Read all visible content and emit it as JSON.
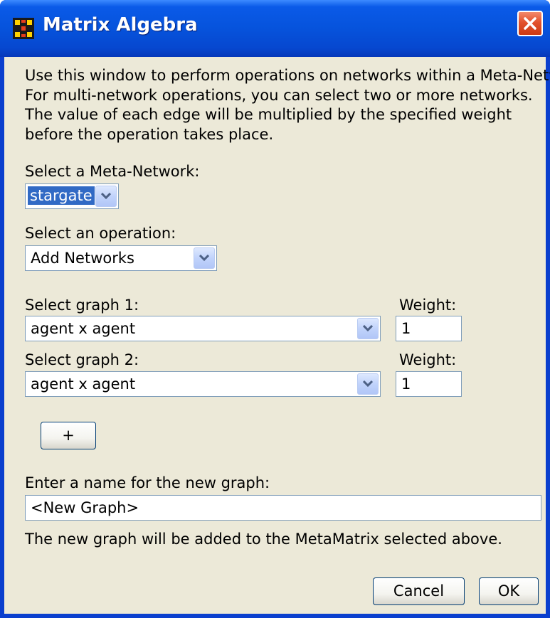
{
  "window": {
    "title": "Matrix Algebra",
    "icon": "ora-app-icon",
    "close_icon": "close-icon"
  },
  "intro": {
    "line1": "Use this window to perform operations on networks within a Meta-Network.",
    "line2": "For multi-network operations, you can select two or more networks.",
    "line3": "The value of each edge will be multiplied by the specified weight",
    "line4": "before the operation takes place."
  },
  "meta_network": {
    "label": "Select a Meta-Network:",
    "value": "stargate"
  },
  "operation": {
    "label": "Select an operation:",
    "value": "Add Networks"
  },
  "graphs": [
    {
      "label": "Select graph 1:",
      "value": "agent x agent",
      "weight_label": "Weight:",
      "weight": "1"
    },
    {
      "label": "Select graph 2:",
      "value": "agent x agent",
      "weight_label": "Weight:",
      "weight": "1"
    }
  ],
  "add_graph_button": "+",
  "new_graph": {
    "label": "Enter a name for the new graph:",
    "value": "<New Graph>",
    "note": "The new graph will be added to the MetaMatrix selected above."
  },
  "buttons": {
    "cancel": "Cancel",
    "ok": "OK"
  },
  "colors": {
    "titlebar": "#0653dc",
    "dialog_bg": "#ece9d8",
    "selection": "#316ac5",
    "close_button": "#e2512c"
  }
}
